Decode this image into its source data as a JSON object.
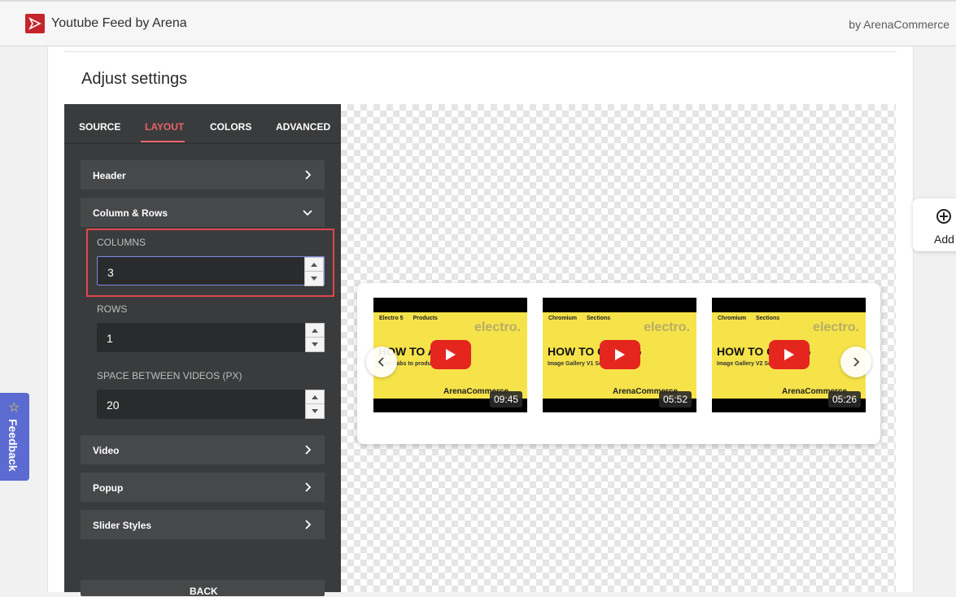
{
  "app": {
    "title": "Youtube Feed by Arena",
    "byline": "by ArenaCommerce"
  },
  "page": {
    "heading": "Adjust settings"
  },
  "tabs": [
    {
      "label": "SOURCE"
    },
    {
      "label": "LAYOUT",
      "active": true
    },
    {
      "label": "COLORS"
    },
    {
      "label": "ADVANCED"
    }
  ],
  "accordion": {
    "header": "Header",
    "columns_rows": "Column & Rows",
    "video": "Video",
    "popup": "Popup",
    "slider_styles": "Slider Styles"
  },
  "fields": {
    "columns": {
      "label": "COLUMNS",
      "value": "3"
    },
    "rows": {
      "label": "ROWS",
      "value": "1"
    },
    "space": {
      "label": "SPACE BETWEEN VIDEOS (PX)",
      "value": "20"
    }
  },
  "back_label": "BACK",
  "videos": [
    {
      "tag1": "Electro 5",
      "tag2": "Products",
      "brand": "electro.",
      "title": "HOW TO ADD",
      "subtitle": "Multi-Tabs to product pages",
      "footer": "ArenaCommerce",
      "duration": "09:45"
    },
    {
      "tag1": "Chromium",
      "tag2": "Sections",
      "brand": "electro.",
      "title": "HOW TO CONFIG",
      "subtitle": "Image Gallery V1 Sections",
      "footer": "ArenaCommerce",
      "duration": "05:52"
    },
    {
      "tag1": "Chromium",
      "tag2": "Sections",
      "brand": "electro.",
      "title": "HOW TO CONFIG",
      "subtitle": "Image Gallery V2 Sections",
      "footer": "ArenaCommerce",
      "duration": "05:26"
    }
  ],
  "add_label": "Add",
  "feedback_label": "Feedback",
  "colors": {
    "accent": "#e8636b",
    "panel": "#3a3b3c",
    "highlight": "#e0464e",
    "feedback": "#5b6bd1"
  }
}
